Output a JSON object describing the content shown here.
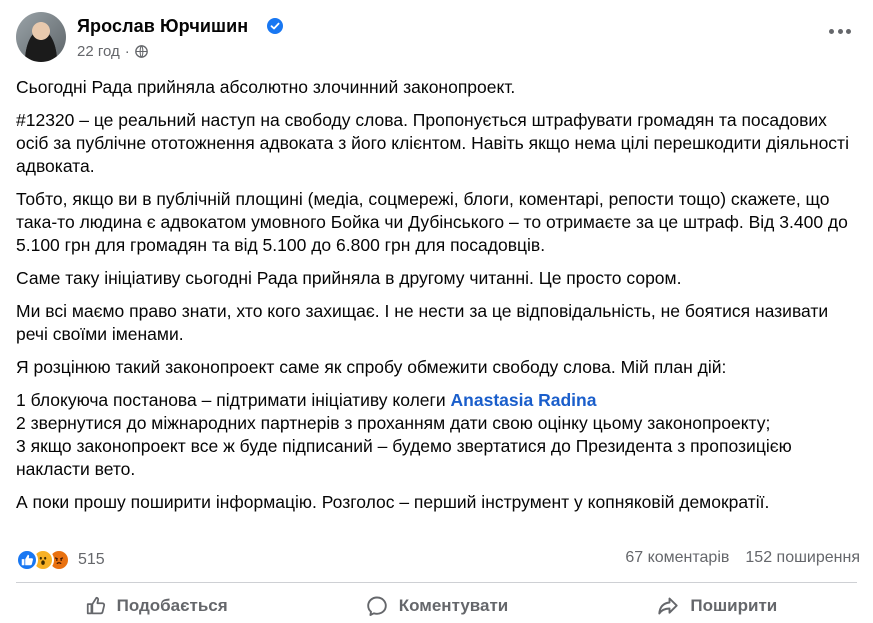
{
  "author": {
    "name": "Ярослав Юрчишин",
    "time": "22 год",
    "separator": "·"
  },
  "post": {
    "p1": "Сьогодні Рада прийняла абсолютно злочинний законопроект.",
    "p2": "#12320 – це реальний наступ на свободу слова. Пропонується штрафувати громадян та посадових осіб за публічне ототожнення адвоката з його клієнтом. Навіть якщо нема цілі перешкодити діяльності адвоката.",
    "p3": "Тобто, якщо ви в публічній площині (медіа, соцмережі, блоги, коментарі, репости тощо) скажете, що така-то людина є адвокатом умовного Бойка чи Дубінського – то отримаєте за це штраф. Від 3.400 до 5.100 грн для громадян та від 5.100 до 6.800 грн для посадовців.",
    "p4": "Саме таку ініціативу сьогодні Рада прийняла в другому читанні. Це просто сором.",
    "p5": "Ми всі маємо право знати, хто кого захищає. І не нести за це відповідальність, не боятися називати речі своїми іменами.",
    "p6": "Я розцінюю такий законопроект саме як спробу обмежити свободу слова. Мій план дій:",
    "list1_prefix": "1 блокуюча постанова – підтримати ініціативу колеги ",
    "list1_mention": "Anastasia Radina",
    "list2": "2 звернутися до міжнародних партнерів з проханням дати свою оцінку цьому законопроекту;",
    "list3": "3 якщо законопроект все ж буде підписаний – будемо звертатися до Президента з пропозицією накласти вето.",
    "p7": "А поки прошу поширити інформацію. Розголос – перший інструмент у копняковій демократії."
  },
  "stats": {
    "reactions_count": "515",
    "comments": "67 коментарів",
    "shares": "152 поширення"
  },
  "actions": {
    "like": "Подобається",
    "comment": "Коментувати",
    "share": "Поширити"
  },
  "icons": {
    "verified": "verified-badge-icon",
    "globe": "globe-icon",
    "more": "more-options-icon",
    "like": "thumbs-up-icon",
    "comment": "comment-bubble-icon",
    "share": "share-arrow-icon"
  },
  "colors": {
    "accent": "#1877f2",
    "mention": "#1a5ecb",
    "secondary_text": "#65676b"
  }
}
